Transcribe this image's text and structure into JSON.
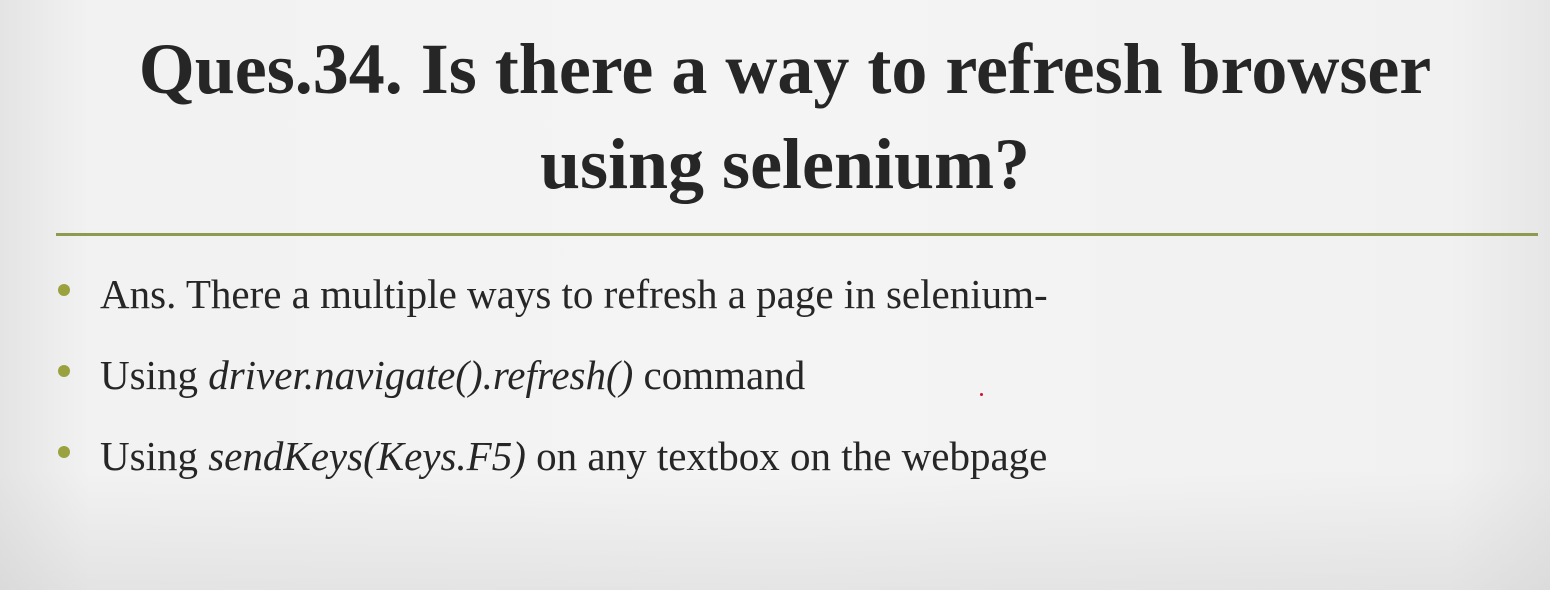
{
  "slide": {
    "title_line1": "Ques.34. Is there a way to refresh browser",
    "title_line2": "using selenium?",
    "accent_color": "#8f9a4f",
    "bullet_color": "#9aa23f",
    "bullets": [
      {
        "text_before": "Ans. There a multiple ways to refresh a page in selenium-",
        "emphasis": "",
        "text_after": ""
      },
      {
        "text_before": "Using ",
        "emphasis": "driver.navigate().refresh()",
        "text_after": " command"
      },
      {
        "text_before": "Using ",
        "emphasis": "sendKeys(Keys.F5)",
        "text_after": " on any textbox on the webpage"
      }
    ]
  }
}
